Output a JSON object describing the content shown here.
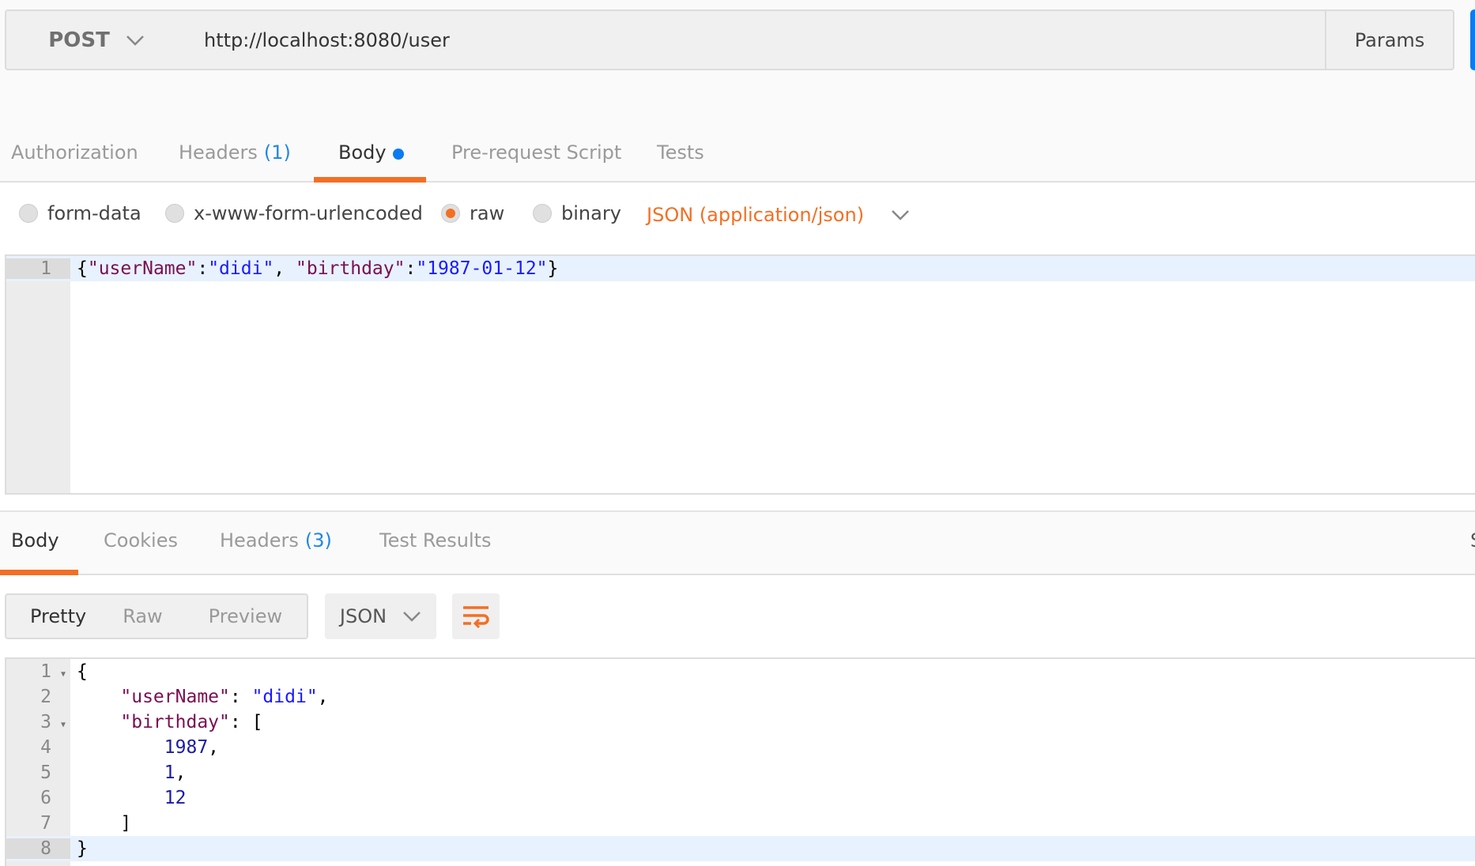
{
  "request": {
    "method": "POST",
    "url": "http://localhost:8080/user",
    "params_label": "Params"
  },
  "request_tabs": [
    {
      "label": "Authorization"
    },
    {
      "label": "Headers",
      "count": "(1)"
    },
    {
      "label": "Body"
    },
    {
      "label": "Pre-request Script"
    },
    {
      "label": "Tests"
    }
  ],
  "body_modes": [
    {
      "label": "form-data",
      "selected": false
    },
    {
      "label": "x-www-form-urlencoded",
      "selected": false
    },
    {
      "label": "raw",
      "selected": true
    },
    {
      "label": "binary",
      "selected": false
    }
  ],
  "content_type": "JSON (application/json)",
  "request_body": {
    "line_number": "1",
    "p1": "{",
    "k1": "\"userName\"",
    "c1": ":",
    "v1": "\"didi\"",
    "c2": ", ",
    "k2": "\"birthday\"",
    "c3": ":",
    "v2": "\"1987-01-12\"",
    "p2": "}"
  },
  "response_tabs": [
    {
      "label": "Body"
    },
    {
      "label": "Cookies"
    },
    {
      "label": "Headers",
      "count": "(3)"
    },
    {
      "label": "Test Results"
    }
  ],
  "response_tabs_overflow": "S",
  "view_modes": [
    "Pretty",
    "Raw",
    "Preview"
  ],
  "response_language": "JSON",
  "response_lines": [
    {
      "n": "1",
      "parts": [
        [
          "p",
          "{"
        ]
      ]
    },
    {
      "n": "2",
      "parts": [
        [
          "p",
          "    "
        ],
        [
          "k",
          "\"userName\""
        ],
        [
          "p",
          ": "
        ],
        [
          "s2",
          "\"didi\""
        ],
        [
          "p",
          ","
        ]
      ]
    },
    {
      "n": "3",
      "parts": [
        [
          "p",
          "    "
        ],
        [
          "k",
          "\"birthday\""
        ],
        [
          "p",
          ": ["
        ]
      ]
    },
    {
      "n": "4",
      "parts": [
        [
          "p",
          "        "
        ],
        [
          "n",
          "1987"
        ],
        [
          "p",
          ","
        ]
      ]
    },
    {
      "n": "5",
      "parts": [
        [
          "p",
          "        "
        ],
        [
          "n",
          "1"
        ],
        [
          "p",
          ","
        ]
      ]
    },
    {
      "n": "6",
      "parts": [
        [
          "p",
          "        "
        ],
        [
          "n",
          "12"
        ]
      ]
    },
    {
      "n": "7",
      "parts": [
        [
          "p",
          "    ]"
        ]
      ]
    },
    {
      "n": "8",
      "parts": [
        [
          "p",
          "}"
        ]
      ]
    }
  ],
  "colors": {
    "accent": "#f36f24",
    "primary": "#0a7bf0",
    "json_key": "#7a0f52",
    "json_string": "#1a1aff",
    "json_number": "#1a1aa6"
  }
}
